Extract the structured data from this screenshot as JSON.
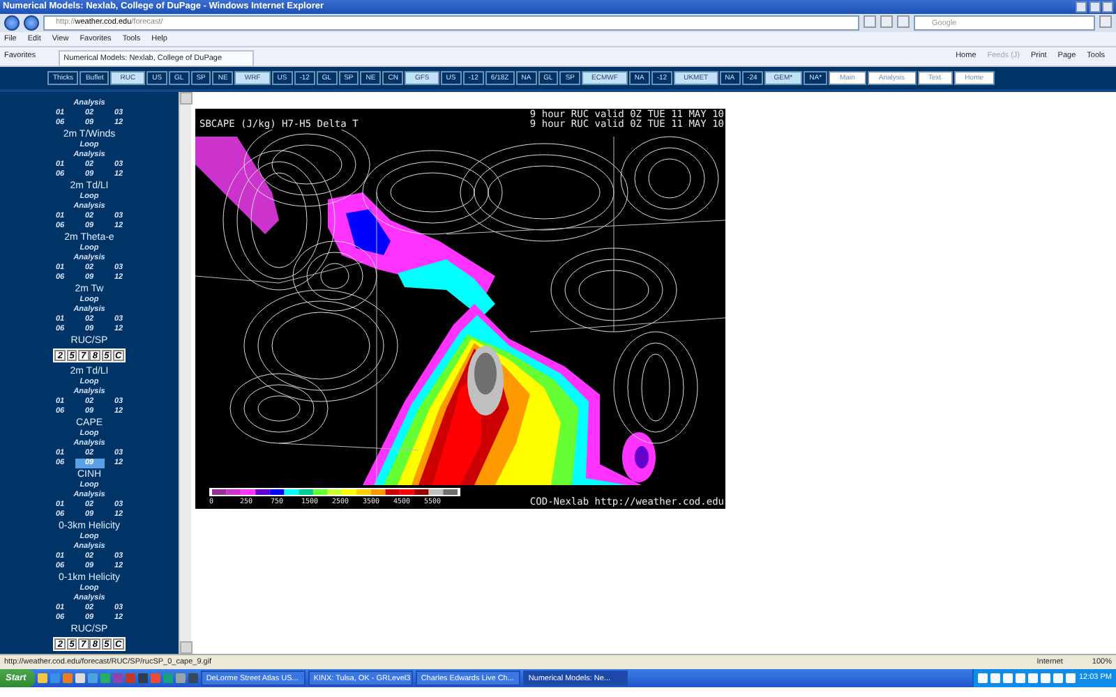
{
  "window": {
    "title": "Numerical Models: Nexlab, College of DuPage - Windows Internet Explorer"
  },
  "address_bar": {
    "prefix": "http://",
    "domain": "weather.cod.edu",
    "path": "/forecast/"
  },
  "search": {
    "placeholder": "Google"
  },
  "menu": [
    "File",
    "Edit",
    "View",
    "Favorites",
    "Tools",
    "Help"
  ],
  "favorites_bar": {
    "favorites": "Favorites",
    "tab": "Numerical Models: Nexlab, College of DuPage",
    "commands": [
      {
        "label": "Home",
        "disabled": false
      },
      {
        "label": "Feeds (J)",
        "disabled": true
      },
      {
        "label": "Print",
        "disabled": false
      },
      {
        "label": "Page",
        "disabled": false
      },
      {
        "label": "Tools",
        "disabled": false
      }
    ]
  },
  "nav": [
    {
      "label": "Thicks",
      "kind": "region"
    },
    {
      "label": "Buflet",
      "kind": "region"
    },
    {
      "label": "RUC",
      "kind": "model"
    },
    {
      "label": "US",
      "kind": "region"
    },
    {
      "label": "GL",
      "kind": "region"
    },
    {
      "label": "SP",
      "kind": "region"
    },
    {
      "label": "NE",
      "kind": "region"
    },
    {
      "label": "WRF",
      "kind": "model"
    },
    {
      "label": "US",
      "kind": "region"
    },
    {
      "label": "-12",
      "kind": "region"
    },
    {
      "label": "GL",
      "kind": "region"
    },
    {
      "label": "SP",
      "kind": "region"
    },
    {
      "label": "NE",
      "kind": "region"
    },
    {
      "label": "CN",
      "kind": "region"
    },
    {
      "label": "GFS",
      "kind": "model"
    },
    {
      "label": "US",
      "kind": "region"
    },
    {
      "label": "-12",
      "kind": "region"
    },
    {
      "label": "6/18Z",
      "kind": "region"
    },
    {
      "label": "NA",
      "kind": "region"
    },
    {
      "label": "GL",
      "kind": "region"
    },
    {
      "label": "SP",
      "kind": "region"
    },
    {
      "label": "ECMWF",
      "kind": "model"
    },
    {
      "label": "NA",
      "kind": "region"
    },
    {
      "label": "-12",
      "kind": "region"
    },
    {
      "label": "UKMET",
      "kind": "model"
    },
    {
      "label": "NA",
      "kind": "region"
    },
    {
      "label": "-24",
      "kind": "region"
    },
    {
      "label": "GEM*",
      "kind": "model"
    },
    {
      "label": "NA*",
      "kind": "region"
    },
    {
      "label": "Main",
      "kind": "page"
    },
    {
      "label": "Analysis",
      "kind": "page"
    },
    {
      "label": "Text",
      "kind": "page"
    },
    {
      "label": "Home",
      "kind": "page"
    }
  ],
  "sidebar": {
    "items": [
      {
        "kind": "field",
        "analysis": "Analysis",
        "hours": [
          {
            "label": "01",
            "selected": false
          },
          {
            "label": "02",
            "selected": false
          },
          {
            "label": "03",
            "selected": false
          },
          {
            "label": "06",
            "selected": false
          },
          {
            "label": "09",
            "selected": false
          },
          {
            "label": "12",
            "selected": false
          }
        ]
      },
      {
        "kind": "field",
        "title": "2m T/Winds",
        "loop": "Loop",
        "analysis": "Analysis",
        "hours": [
          {
            "label": "01",
            "selected": false
          },
          {
            "label": "02",
            "selected": false
          },
          {
            "label": "03",
            "selected": false
          },
          {
            "label": "06",
            "selected": false
          },
          {
            "label": "09",
            "selected": false
          },
          {
            "label": "12",
            "selected": false
          }
        ]
      },
      {
        "kind": "field",
        "title": "2m Td/LI",
        "loop": "Loop",
        "analysis": "Analysis",
        "hours": [
          {
            "label": "01",
            "selected": false
          },
          {
            "label": "02",
            "selected": false
          },
          {
            "label": "03",
            "selected": false
          },
          {
            "label": "06",
            "selected": false
          },
          {
            "label": "09",
            "selected": false
          },
          {
            "label": "12",
            "selected": false
          }
        ]
      },
      {
        "kind": "field",
        "title": "2m Theta-e",
        "loop": "Loop",
        "analysis": "Analysis",
        "hours": [
          {
            "label": "01",
            "selected": false
          },
          {
            "label": "02",
            "selected": false
          },
          {
            "label": "03",
            "selected": false
          },
          {
            "label": "06",
            "selected": false
          },
          {
            "label": "09",
            "selected": false
          },
          {
            "label": "12",
            "selected": false
          }
        ]
      },
      {
        "kind": "field",
        "title": "2m Tw",
        "loop": "Loop",
        "analysis": "Analysis",
        "hours": [
          {
            "label": "01",
            "selected": false
          },
          {
            "label": "02",
            "selected": false
          },
          {
            "label": "03",
            "selected": false
          },
          {
            "label": "06",
            "selected": false
          },
          {
            "label": "09",
            "selected": false
          },
          {
            "label": "12",
            "selected": false
          }
        ]
      },
      {
        "kind": "model",
        "title": "RUC/SP",
        "buttons": [
          "2",
          "5",
          "7",
          "8",
          "5",
          "C"
        ]
      },
      {
        "kind": "field",
        "title": "2m Td/LI",
        "loop": "Loop",
        "analysis": "Analysis",
        "hours": [
          {
            "label": "01",
            "selected": false
          },
          {
            "label": "02",
            "selected": false
          },
          {
            "label": "03",
            "selected": false
          },
          {
            "label": "06",
            "selected": false
          },
          {
            "label": "09",
            "selected": false
          },
          {
            "label": "12",
            "selected": false
          }
        ]
      },
      {
        "kind": "field",
        "title": "CAPE",
        "loop": "Loop",
        "analysis": "Analysis",
        "hours": [
          {
            "label": "01",
            "selected": false
          },
          {
            "label": "02",
            "selected": false
          },
          {
            "label": "03",
            "selected": false
          },
          {
            "label": "06",
            "selected": false
          },
          {
            "label": "09",
            "selected": true
          },
          {
            "label": "12",
            "selected": false
          }
        ]
      },
      {
        "kind": "field",
        "title": "CINH",
        "loop": "Loop",
        "analysis": "Analysis",
        "hours": [
          {
            "label": "01",
            "selected": false
          },
          {
            "label": "02",
            "selected": false
          },
          {
            "label": "03",
            "selected": false
          },
          {
            "label": "06",
            "selected": false
          },
          {
            "label": "09",
            "selected": false
          },
          {
            "label": "12",
            "selected": false
          }
        ]
      },
      {
        "kind": "field",
        "title": "0-3km Helicity",
        "loop": "Loop",
        "analysis": "Analysis",
        "hours": [
          {
            "label": "01",
            "selected": false
          },
          {
            "label": "02",
            "selected": false
          },
          {
            "label": "03",
            "selected": false
          },
          {
            "label": "06",
            "selected": false
          },
          {
            "label": "09",
            "selected": false
          },
          {
            "label": "12",
            "selected": false
          }
        ]
      },
      {
        "kind": "field",
        "title": "0-1km Helicity",
        "loop": "Loop",
        "analysis": "Analysis",
        "hours": [
          {
            "label": "01",
            "selected": false
          },
          {
            "label": "02",
            "selected": false
          },
          {
            "label": "03",
            "selected": false
          },
          {
            "label": "06",
            "selected": false
          },
          {
            "label": "09",
            "selected": false
          },
          {
            "label": "12",
            "selected": false
          }
        ]
      },
      {
        "kind": "model",
        "title": "RUC/SP",
        "buttons": [
          "2",
          "5",
          "7",
          "8",
          "5",
          "C"
        ]
      }
    ]
  },
  "map": {
    "title": "SBCAPE (J/kg) H7-H5 Delta T",
    "valid_lines": [
      "9 hour RUC valid 0Z TUE 11 MAY 10",
      "9 hour RUC valid 0Z TUE 11 MAY 10"
    ],
    "legend": {
      "steps": [
        {
          "color": "#993399"
        },
        {
          "color": "#cc33cc"
        },
        {
          "color": "#ff33ff"
        },
        {
          "color": "#6600cc"
        },
        {
          "color": "#0000ff"
        },
        {
          "color": "#00ffff"
        },
        {
          "color": "#00cc99"
        },
        {
          "color": "#66ff33"
        },
        {
          "color": "#ccff33"
        },
        {
          "color": "#ffff00"
        },
        {
          "color": "#ffcc00"
        },
        {
          "color": "#ff9900"
        },
        {
          "color": "#cc0000"
        },
        {
          "color": "#ff0000"
        },
        {
          "color": "#990000"
        },
        {
          "color": "#c0c0c0"
        },
        {
          "color": "#707070"
        }
      ],
      "labels": [
        "0",
        "250",
        "750",
        "1500",
        "2500",
        "3500",
        "4500",
        "5500"
      ]
    },
    "credit": "COD-Nexlab http://weather.cod.edu"
  },
  "status_bar": {
    "url": "http://weather.cod.edu/forecast/RUC/SP/rucSP_0_cape_9.gif",
    "zone": "Internet",
    "zoom": "100%"
  },
  "taskbar": {
    "start": "Start",
    "tasks": [
      {
        "label": "DeLorme Street Atlas US...",
        "selected": false
      },
      {
        "label": "KINX: Tulsa, OK - GRLevel3",
        "selected": false
      },
      {
        "label": "Charles Edwards Live Ch...",
        "selected": false
      },
      {
        "label": "Numerical Models: Ne...",
        "selected": true
      }
    ],
    "clock": "12:03 PM"
  }
}
